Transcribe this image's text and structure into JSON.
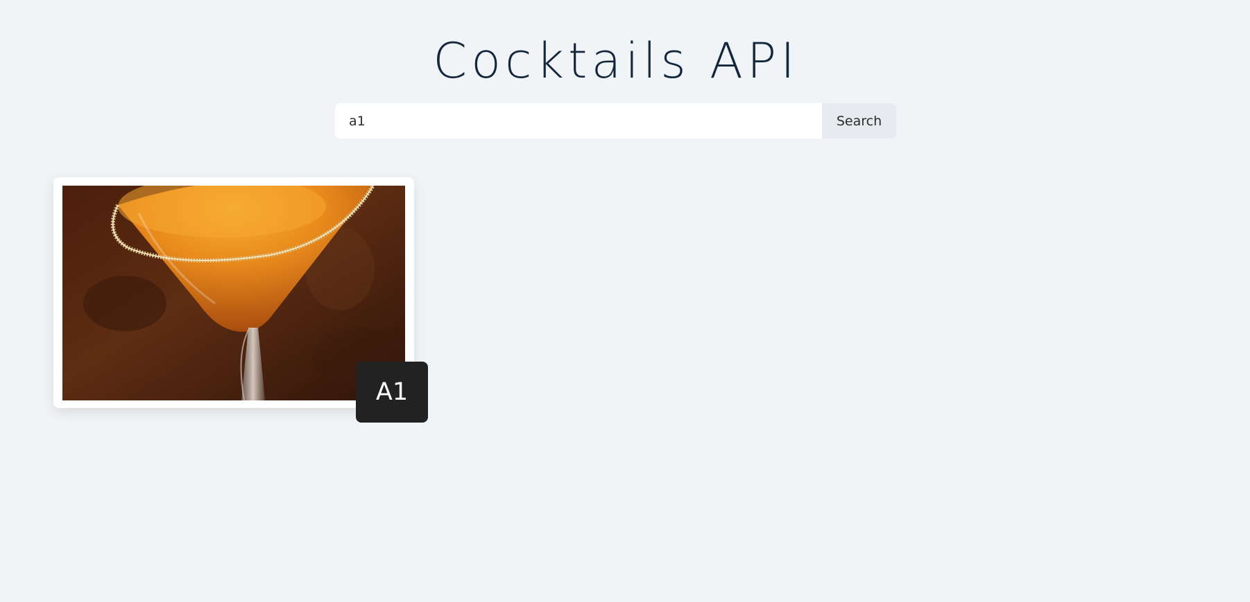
{
  "header": {
    "title": "Cocktails API"
  },
  "search": {
    "value": "a1",
    "button_label": "Search"
  },
  "results": [
    {
      "name": "A1",
      "image": "cocktail-glass-photo"
    }
  ],
  "colors": {
    "background": "#f0f4f7",
    "title": "#13263b",
    "badge": "#222222",
    "button": "#e7eaee"
  }
}
